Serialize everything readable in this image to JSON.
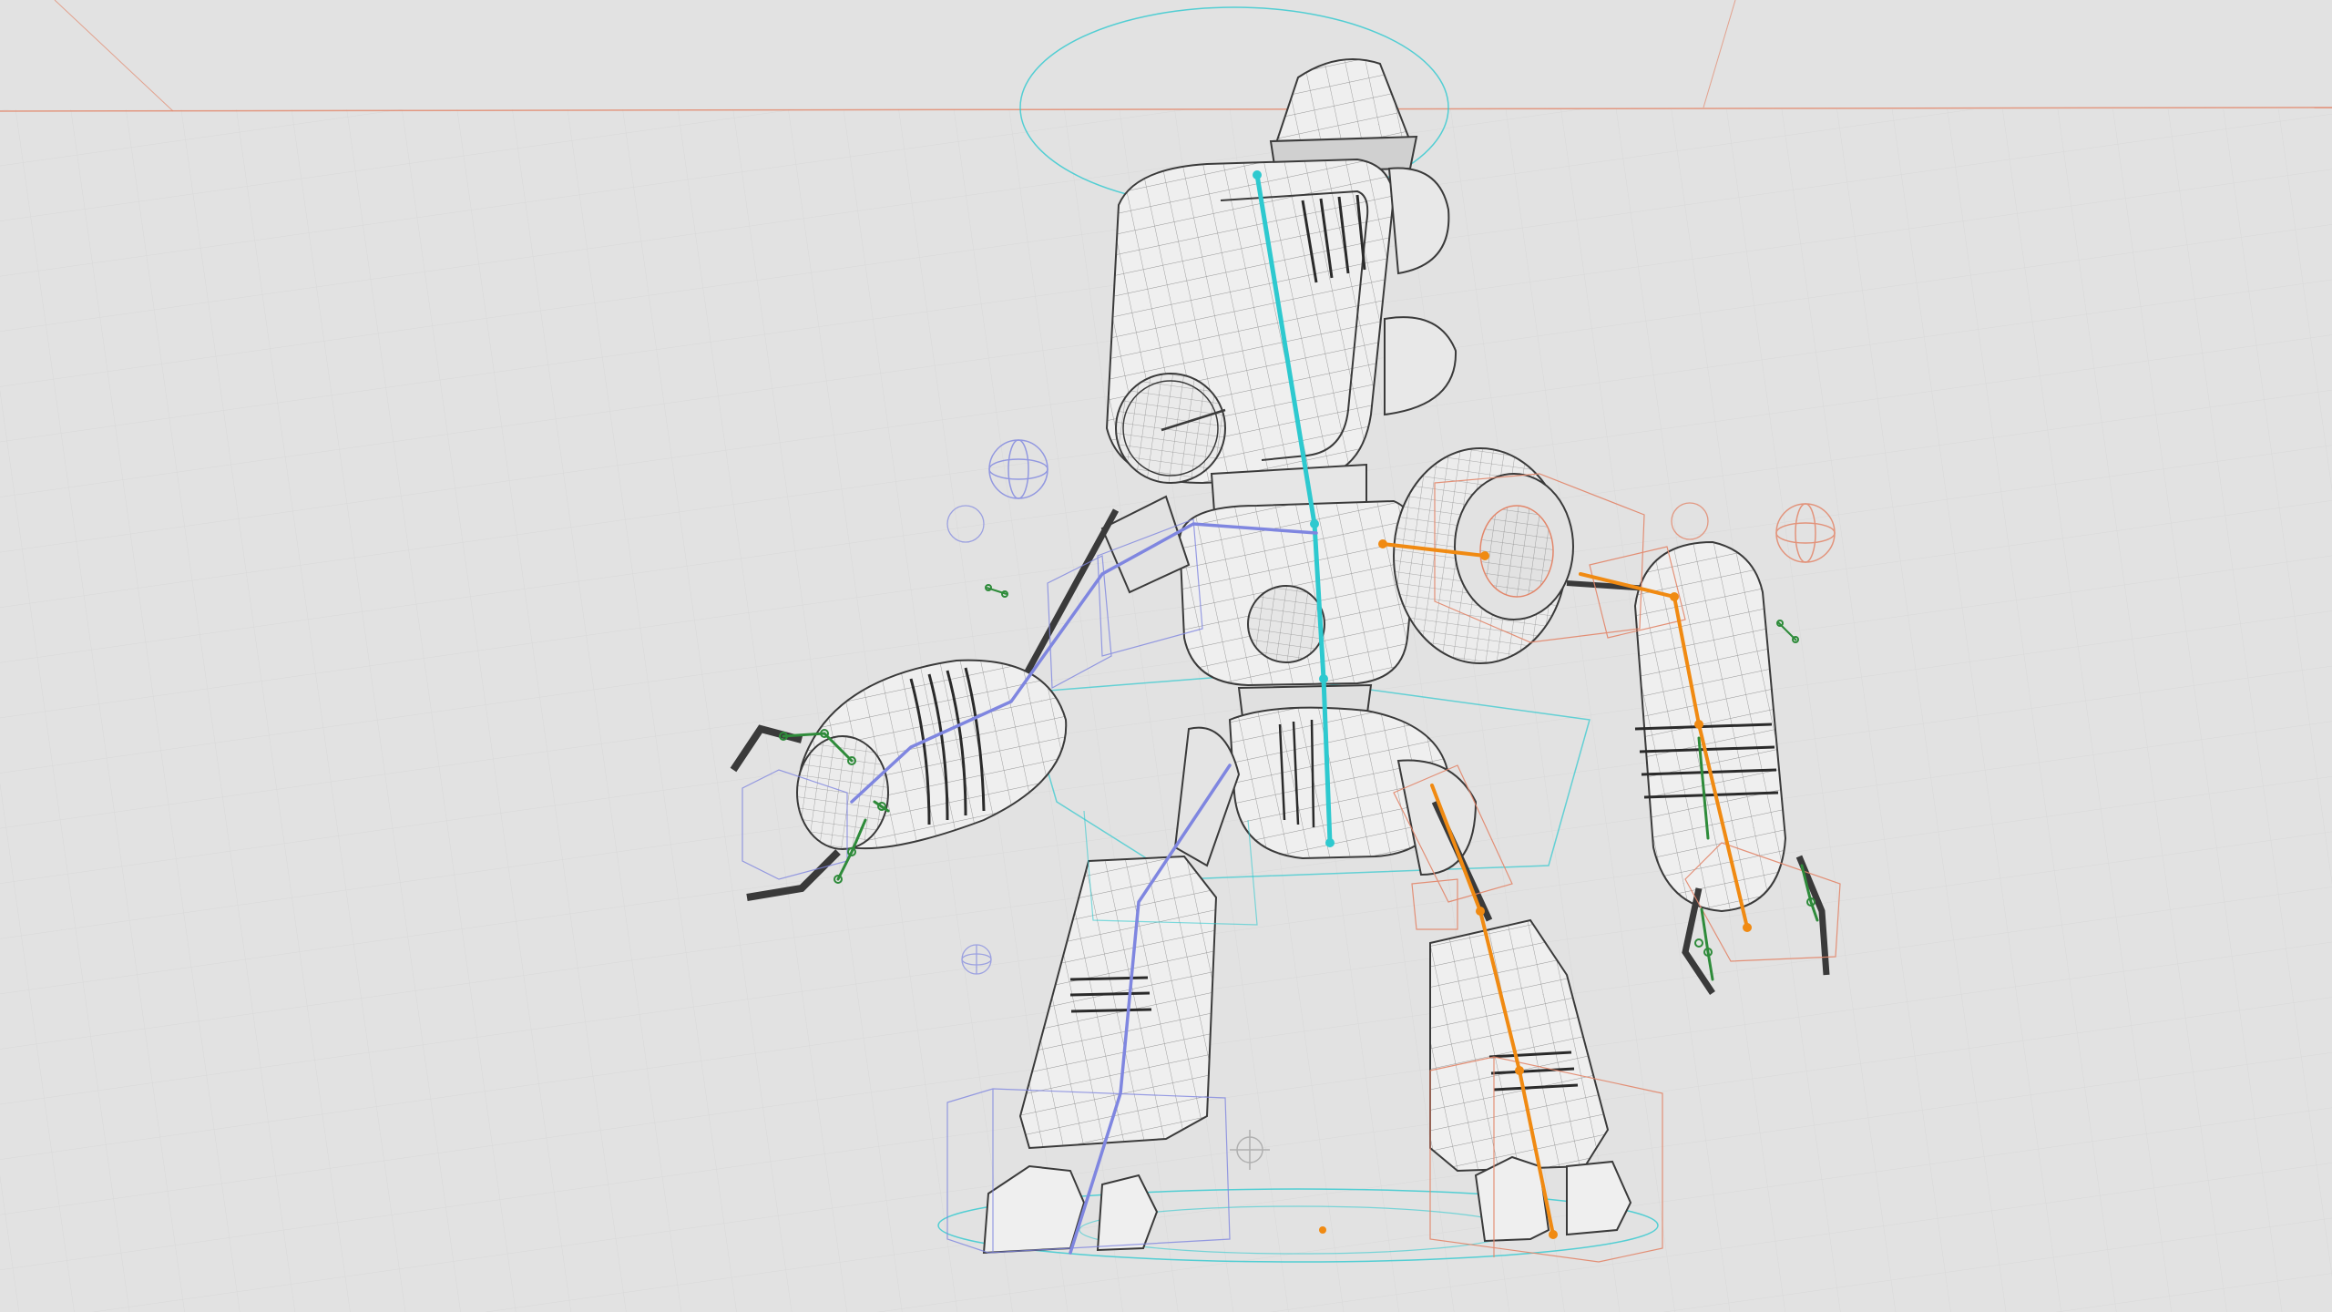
{
  "scene": {
    "subject": "robot-character-rig",
    "view_mode": "wireframe",
    "colors": {
      "background": "#e2e2e2",
      "mesh": "#3a3a3a",
      "mesh_fill": "#efefef",
      "spine_rig": "#2ec9cf",
      "left_side_rig": "#f08a12",
      "right_side_rig": "#7f86e0",
      "finger_rig": "#2e8b3a",
      "ground_line": "#e2866a"
    },
    "bone_chains": [
      "spine",
      "left-arm",
      "right-arm",
      "left-leg",
      "right-leg",
      "fingers"
    ],
    "controls": [
      "root-circle",
      "hip-control",
      "head-control",
      "ik-target-spheres",
      "foot-control-boxes"
    ]
  }
}
